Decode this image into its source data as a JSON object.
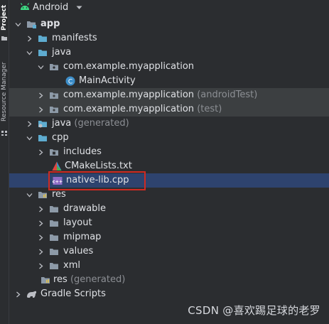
{
  "tool_strip": {
    "project_tab": "Project",
    "resource_tab": "Resource Manager"
  },
  "header": {
    "title": "Android",
    "dropdown_icon": "chevron-down-icon"
  },
  "tree": {
    "rows": [
      {
        "name": "app",
        "sub": ""
      },
      {
        "name": "manifests",
        "sub": ""
      },
      {
        "name": "java",
        "sub": ""
      },
      {
        "name": "com.example.myapplication",
        "sub": ""
      },
      {
        "name": "MainActivity",
        "sub": ""
      },
      {
        "name": "com.example.myapplication",
        "sub": "(androidTest)"
      },
      {
        "name": "com.example.myapplication",
        "sub": "(test)"
      },
      {
        "name": "java",
        "sub": "(generated)"
      },
      {
        "name": "cpp",
        "sub": ""
      },
      {
        "name": "includes",
        "sub": ""
      },
      {
        "name": "CMakeLists.txt",
        "sub": ""
      },
      {
        "name": "native-lib.cpp",
        "sub": ""
      },
      {
        "name": "res",
        "sub": ""
      },
      {
        "name": "drawable",
        "sub": ""
      },
      {
        "name": "layout",
        "sub": ""
      },
      {
        "name": "mipmap",
        "sub": ""
      },
      {
        "name": "values",
        "sub": ""
      },
      {
        "name": "xml",
        "sub": ""
      },
      {
        "name": "res",
        "sub": "(generated)"
      },
      {
        "name": "Gradle Scripts",
        "sub": ""
      }
    ]
  },
  "colors": {
    "background": "#2b2d30",
    "selection": "#2e436e",
    "highlight_box": "#cf2a22",
    "android_green": "#3ddc84"
  },
  "watermark": "CSDN @喜欢踢足球的老罗"
}
